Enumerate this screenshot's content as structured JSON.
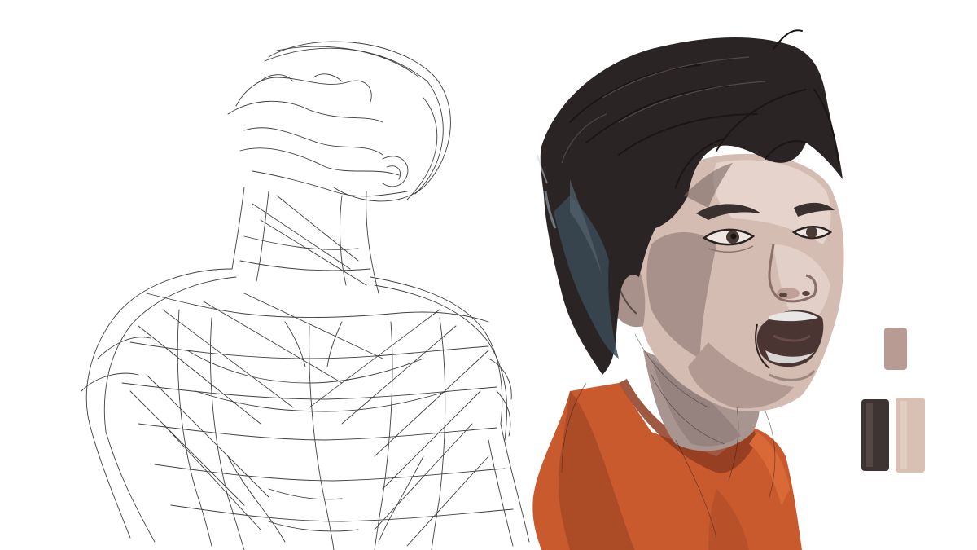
{
  "artwork": {
    "sketch_color": "#1e1e1e",
    "background": "#ffffff",
    "hair_color": "#2a2524",
    "hair_shadow_blue": "#3a4a55",
    "skin_light": "#e6d4cc",
    "skin_mid": "#c9aea5",
    "skin_shadow": "#9b8680",
    "mouth_dark": "#4a3533",
    "teeth": "#e8e6e6",
    "jacket_orange": "#c85a2e",
    "jacket_dark": "#8e3b20",
    "swatches": [
      "#b89c94",
      "#3e3533",
      "#d8c0b4"
    ]
  }
}
